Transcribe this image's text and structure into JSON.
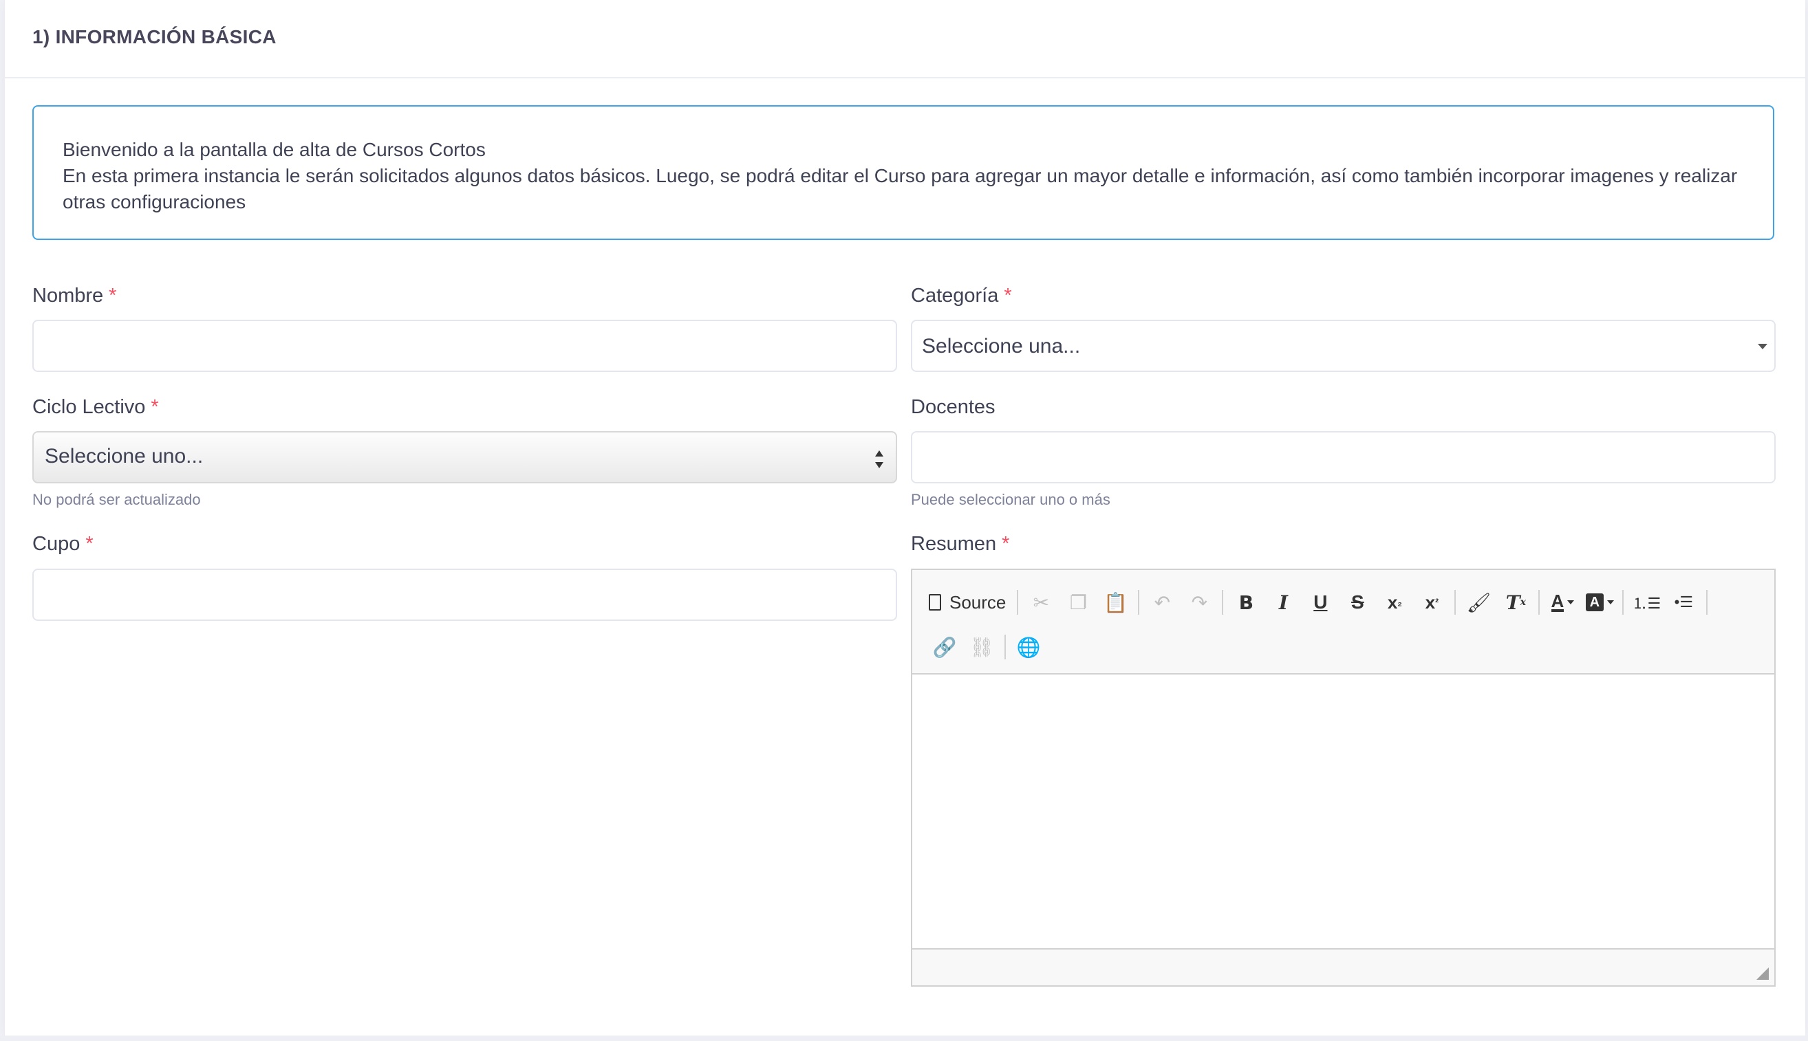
{
  "section": {
    "title": "1) INFORMACIÓN BÁSICA"
  },
  "info": {
    "line1": "Bienvenido a la pantalla de alta de Cursos Cortos",
    "line2": "En esta primera instancia le serán solicitados algunos datos básicos. Luego, se podrá editar el Curso para agregar un mayor detalle e información, así como también incorporar imagenes y realizar otras configuraciones"
  },
  "fields": {
    "nombre": {
      "label": "Nombre",
      "required": "*",
      "value": ""
    },
    "categoria": {
      "label": "Categoría",
      "required": "*",
      "selected": "Seleccione una..."
    },
    "ciclo": {
      "label": "Ciclo Lectivo",
      "required": "*",
      "selected": "Seleccione uno...",
      "help": "No podrá ser actualizado"
    },
    "docentes": {
      "label": "Docentes",
      "value": "",
      "help": "Puede seleccionar uno o más"
    },
    "cupo": {
      "label": "Cupo",
      "required": "*",
      "value": ""
    },
    "resumen": {
      "label": "Resumen",
      "required": "*"
    }
  },
  "editor": {
    "source_label": "Source",
    "toolbar_icons": [
      "source-icon",
      "cut-icon",
      "copy-icon",
      "paste-icon",
      "undo-icon",
      "redo-icon",
      "bold-icon",
      "italic-icon",
      "underline-icon",
      "strikethrough-icon",
      "subscript-icon",
      "superscript-icon",
      "format-painter-icon",
      "remove-format-icon",
      "text-color-icon",
      "background-color-icon",
      "numbered-list-icon",
      "bulleted-list-icon",
      "link-icon",
      "unlink-icon",
      "globe-icon"
    ],
    "content": ""
  }
}
